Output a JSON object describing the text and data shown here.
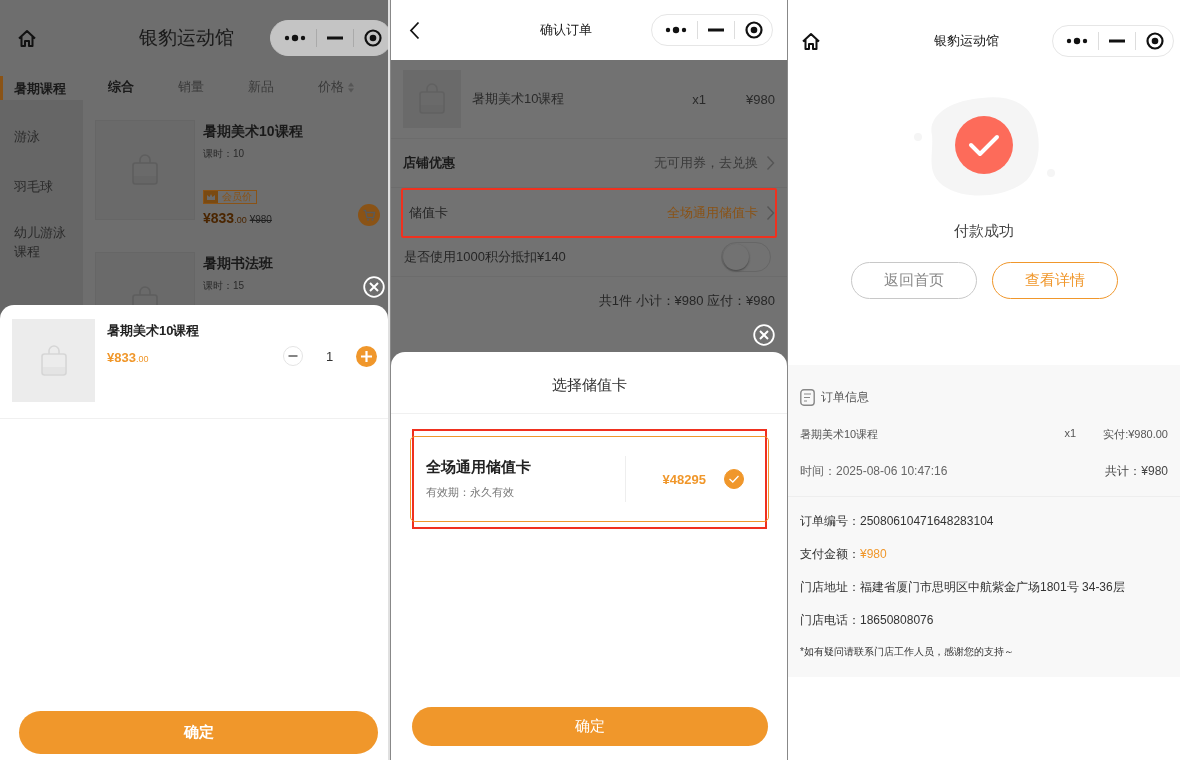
{
  "category_screen": {
    "title": "银豹运动馆",
    "categories": [
      {
        "label": "暑期课程",
        "selected": true
      },
      {
        "label": "游泳",
        "selected": false
      },
      {
        "label": "羽毛球",
        "selected": false
      },
      {
        "label": "幼儿游泳课程",
        "selected": false
      }
    ],
    "sort_tabs": [
      {
        "label": "综合",
        "selected": true,
        "kind": "plain"
      },
      {
        "label": "销量",
        "selected": false,
        "kind": "plain"
      },
      {
        "label": "新品",
        "selected": false,
        "kind": "plain"
      },
      {
        "label": "价格",
        "selected": false,
        "kind": "sortable"
      }
    ],
    "products": [
      {
        "title": "暑期美术10课程",
        "lessons": "课时：10",
        "badge": "会员价",
        "price": "¥833.00",
        "original_price": "¥980"
      },
      {
        "title": "暑期书法班",
        "lessons": "课时：15"
      }
    ],
    "sheet": {
      "title": "暑期美术10课程",
      "price": "¥833.00",
      "quantity": "1",
      "confirm": "确定"
    }
  },
  "order_screen": {
    "title": "确认订单",
    "item": {
      "title": "暑期美术10课程",
      "quantity": "x1",
      "price": "¥980"
    },
    "rows": [
      {
        "label": "店铺优惠",
        "value": "无可用券，去兑换",
        "kind": "coupon"
      },
      {
        "label": "储值卡",
        "value": "全场通用储值卡",
        "highlighted": true,
        "kind": "card"
      }
    ],
    "points": {
      "label": "是否使用1000积分抵扣¥140",
      "on": false
    },
    "summary": "共1件 小计：¥980 应付：¥980",
    "sheet": {
      "title": "选择储值卡",
      "cards": [
        {
          "name": "全场通用储值卡",
          "validity": "有效期：永久有效",
          "balance": "¥48295",
          "selected": true,
          "highlighted": true
        }
      ],
      "confirm": "确定"
    }
  },
  "success_screen": {
    "title": "银豹运动馆",
    "status": "付款成功",
    "buttons": [
      {
        "label": "返回首页",
        "kind": "secondary"
      },
      {
        "label": "查看详情",
        "kind": "primary"
      }
    ],
    "order_info": {
      "heading": "订单信息",
      "item": {
        "title": "暑期美术10课程",
        "quantity": "x1",
        "paid": "实付:¥980.00"
      },
      "time": "时间：2025-08-06 10:47:16",
      "total": "共计：¥980",
      "details": [
        {
          "label": "订单编号：",
          "value": "25080610471648283104",
          "kind": "plain"
        },
        {
          "label": "支付金额：",
          "value": "¥980",
          "kind": "amount"
        },
        {
          "label": "门店地址：",
          "value": "福建省厦门市思明区中航紫金广场1801号 34-36层",
          "kind": "plain"
        },
        {
          "label": "门店电话：",
          "value": "18650808076",
          "kind": "plain"
        }
      ],
      "note": "*如有疑问请联系门店工作人员，感谢您的支持～"
    }
  }
}
